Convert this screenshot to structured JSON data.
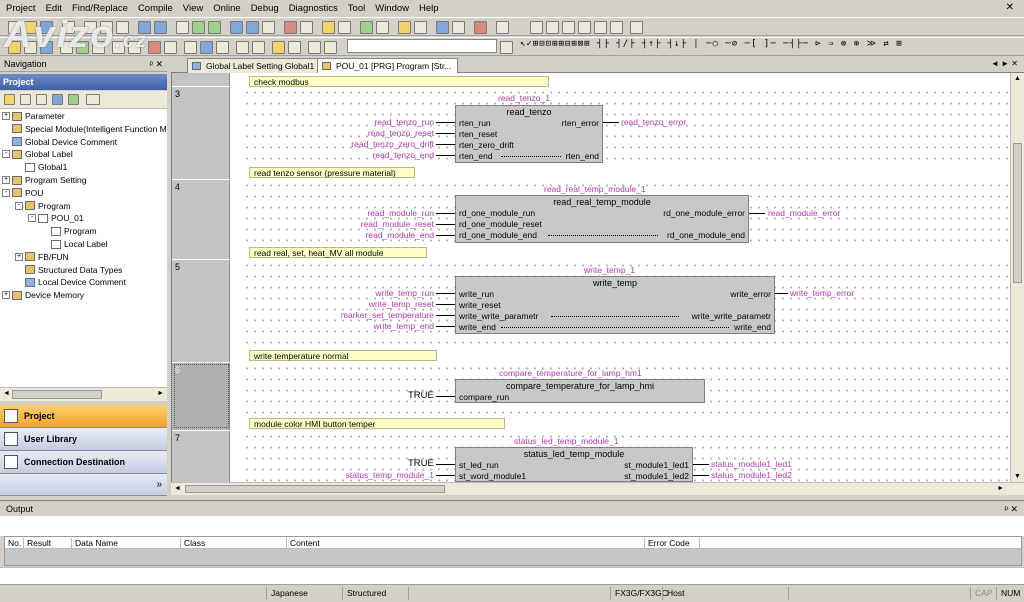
{
  "menu": [
    "Project",
    "Edit",
    "Find/Replace",
    "Compile",
    "View",
    "Online",
    "Debug",
    "Diagnostics",
    "Tool",
    "Window",
    "Help"
  ],
  "watermark": {
    "main": "Avizo",
    "suffix": ".cz"
  },
  "navigation": {
    "title": "Navigation",
    "pin_icon": "pin-icon",
    "header": "Project",
    "tree": [
      {
        "label": "Parameter",
        "level": 0,
        "expander": "+",
        "icon": "folder"
      },
      {
        "label": "Special Module(Intelligent Function M",
        "level": 0,
        "expander": "",
        "icon": "folder"
      },
      {
        "label": "Global Device Comment",
        "level": 0,
        "expander": "",
        "icon": "comment"
      },
      {
        "label": "Global Label",
        "level": 0,
        "expander": "-",
        "icon": "folder"
      },
      {
        "label": "Global1",
        "level": 1,
        "expander": "",
        "icon": "doc"
      },
      {
        "label": "Program Setting",
        "level": 0,
        "expander": "+",
        "icon": "folder"
      },
      {
        "label": "POU",
        "level": 0,
        "expander": "-",
        "icon": "folder"
      },
      {
        "label": "Program",
        "level": 1,
        "expander": "-",
        "icon": "folder"
      },
      {
        "label": "POU_01",
        "level": 2,
        "expander": "-",
        "icon": "doc"
      },
      {
        "label": "Program",
        "level": 3,
        "expander": "",
        "icon": "doc"
      },
      {
        "label": "Local Label",
        "level": 3,
        "expander": "",
        "icon": "doc"
      },
      {
        "label": "FB/FUN",
        "level": 1,
        "expander": "+",
        "icon": "folder"
      },
      {
        "label": "Structured Data Types",
        "level": 1,
        "expander": "",
        "icon": "folder"
      },
      {
        "label": "Local Device Comment",
        "level": 1,
        "expander": "",
        "icon": "comment"
      },
      {
        "label": "Device Memory",
        "level": 0,
        "expander": "+",
        "icon": "folder"
      }
    ],
    "buttons": {
      "project": "Project",
      "user_library": "User Library",
      "connection": "Connection Destination"
    },
    "footer_chevron": "»"
  },
  "tabs": [
    {
      "label": "Global Label Setting Global1",
      "active": false
    },
    {
      "label": "POU_01 [PRG] Program [Str...",
      "active": true
    }
  ],
  "tab_nav": "◄ ► ✕",
  "rungs": {
    "r0": {
      "comment": "check modbus"
    },
    "r3": {
      "num": "3",
      "instance": "read_tenzo_1",
      "fb": "read_tenzo",
      "in_pins": [
        "rten_run",
        "rten_reset",
        "rten_zero_drift",
        "rten_end"
      ],
      "in_vars": [
        "read_tenzo_run",
        "read_tenzo_reset",
        "read_tenzo_zero_drift",
        "read_tenzo_end"
      ],
      "out_pins": [
        "rten_error",
        "rten_end"
      ],
      "out_vars": [
        "read_tenzo_error"
      ],
      "comment": "read tenzo sensor (pressure material)"
    },
    "r4": {
      "num": "4",
      "instance": "read_real_temp_module_1",
      "fb": "read_real_temp_module",
      "in_pins": [
        "rd_one_module_run",
        "rd_one_module_reset",
        "rd_one_module_end"
      ],
      "in_vars": [
        "read_module_run",
        "read_module_reset",
        "read_module_end"
      ],
      "out_pins": [
        "rd_one_module_error",
        "rd_one_module_end"
      ],
      "out_vars": [
        "read_module_error"
      ],
      "comment": "read real, set, heat_MV all module"
    },
    "r5": {
      "num": "5",
      "instance": "write_temp_1",
      "fb": "write_temp",
      "in_pins": [
        "write_run",
        "write_reset",
        "write_write_parametr",
        "write_end"
      ],
      "in_vars": [
        "write_temp_run",
        "write_temp_reset",
        "marker_set_temperature",
        "write_temp_end"
      ],
      "out_pins": [
        "write_error",
        "write_write_parametr",
        "write_end"
      ],
      "out_vars": [
        "write_temp_error"
      ],
      "comment": "write temperature normal"
    },
    "r6": {
      "num": "6",
      "instance": "compare_temperature_for_lamp_hm1",
      "fb": "compare_temperature_for_lamp_hmi",
      "in_pins": [
        "compare_run"
      ],
      "const": "TRUE",
      "comment": "module color HMI button temper"
    },
    "r7": {
      "num": "7",
      "instance": "status_led_temp_module_1",
      "fb": "status_led_temp_module",
      "in_pins": [
        "st_led_run",
        "st_word_module1"
      ],
      "const": "TRUE",
      "in_vars": [
        "status_temp_module_1"
      ],
      "out_pins": [
        "st_module1_led1",
        "st_module1_led2"
      ],
      "out_vars": [
        "status_module1_led1",
        "status_module1_led2"
      ]
    }
  },
  "output": {
    "title": "Output",
    "columns": [
      "No.",
      "Result",
      "Data Name",
      "Class",
      "Content",
      "Error Code"
    ]
  },
  "status": {
    "language": "Japanese",
    "mode": "Structured",
    "plc": "FX3G/FX3GC",
    "host": "Host",
    "cap": "CAP",
    "num": "NUM"
  }
}
